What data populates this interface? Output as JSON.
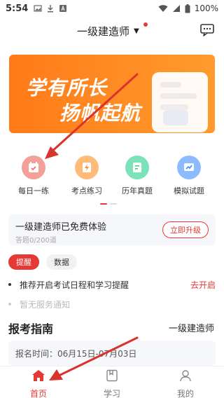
{
  "status_bar": {
    "time": "5:54",
    "battery": "100%"
  },
  "header": {
    "exam_selector": "一级建造师"
  },
  "banner": {
    "line1": "学有所长",
    "line2": "扬帆起航"
  },
  "features": [
    {
      "label": "每日一练",
      "icon": "calendar-icon",
      "color": "#f0675c"
    },
    {
      "label": "考点练习",
      "icon": "lightning-icon",
      "color": "#ff8f3d"
    },
    {
      "label": "历年真题",
      "icon": "document-icon",
      "color": "#2ed08f"
    },
    {
      "label": "模拟试题",
      "icon": "chart-icon",
      "color": "#3d8bff"
    }
  ],
  "trial": {
    "title": "一级建造师已免费体验",
    "progress": "答题0/200道",
    "upgrade_label": "立即升级"
  },
  "tabs": [
    {
      "label": "提醒"
    },
    {
      "label": "数据"
    }
  ],
  "reminders": [
    {
      "text": "推荐开启考试日程和学习提醒",
      "action": "去开启"
    },
    {
      "text": "暂无服务通知"
    }
  ],
  "guide": {
    "title": "报考指南",
    "category": "一级建造师",
    "date_text": "报名时间：06月15日-07月03日"
  },
  "bottom_nav": [
    {
      "label": "首页",
      "icon": "home-icon",
      "active": true
    },
    {
      "label": "学习",
      "icon": "book-icon",
      "active": false
    },
    {
      "label": "我的",
      "icon": "profile-icon",
      "active": false
    }
  ],
  "colors": {
    "accent": "#e53935",
    "banner": "#ff8a24"
  }
}
